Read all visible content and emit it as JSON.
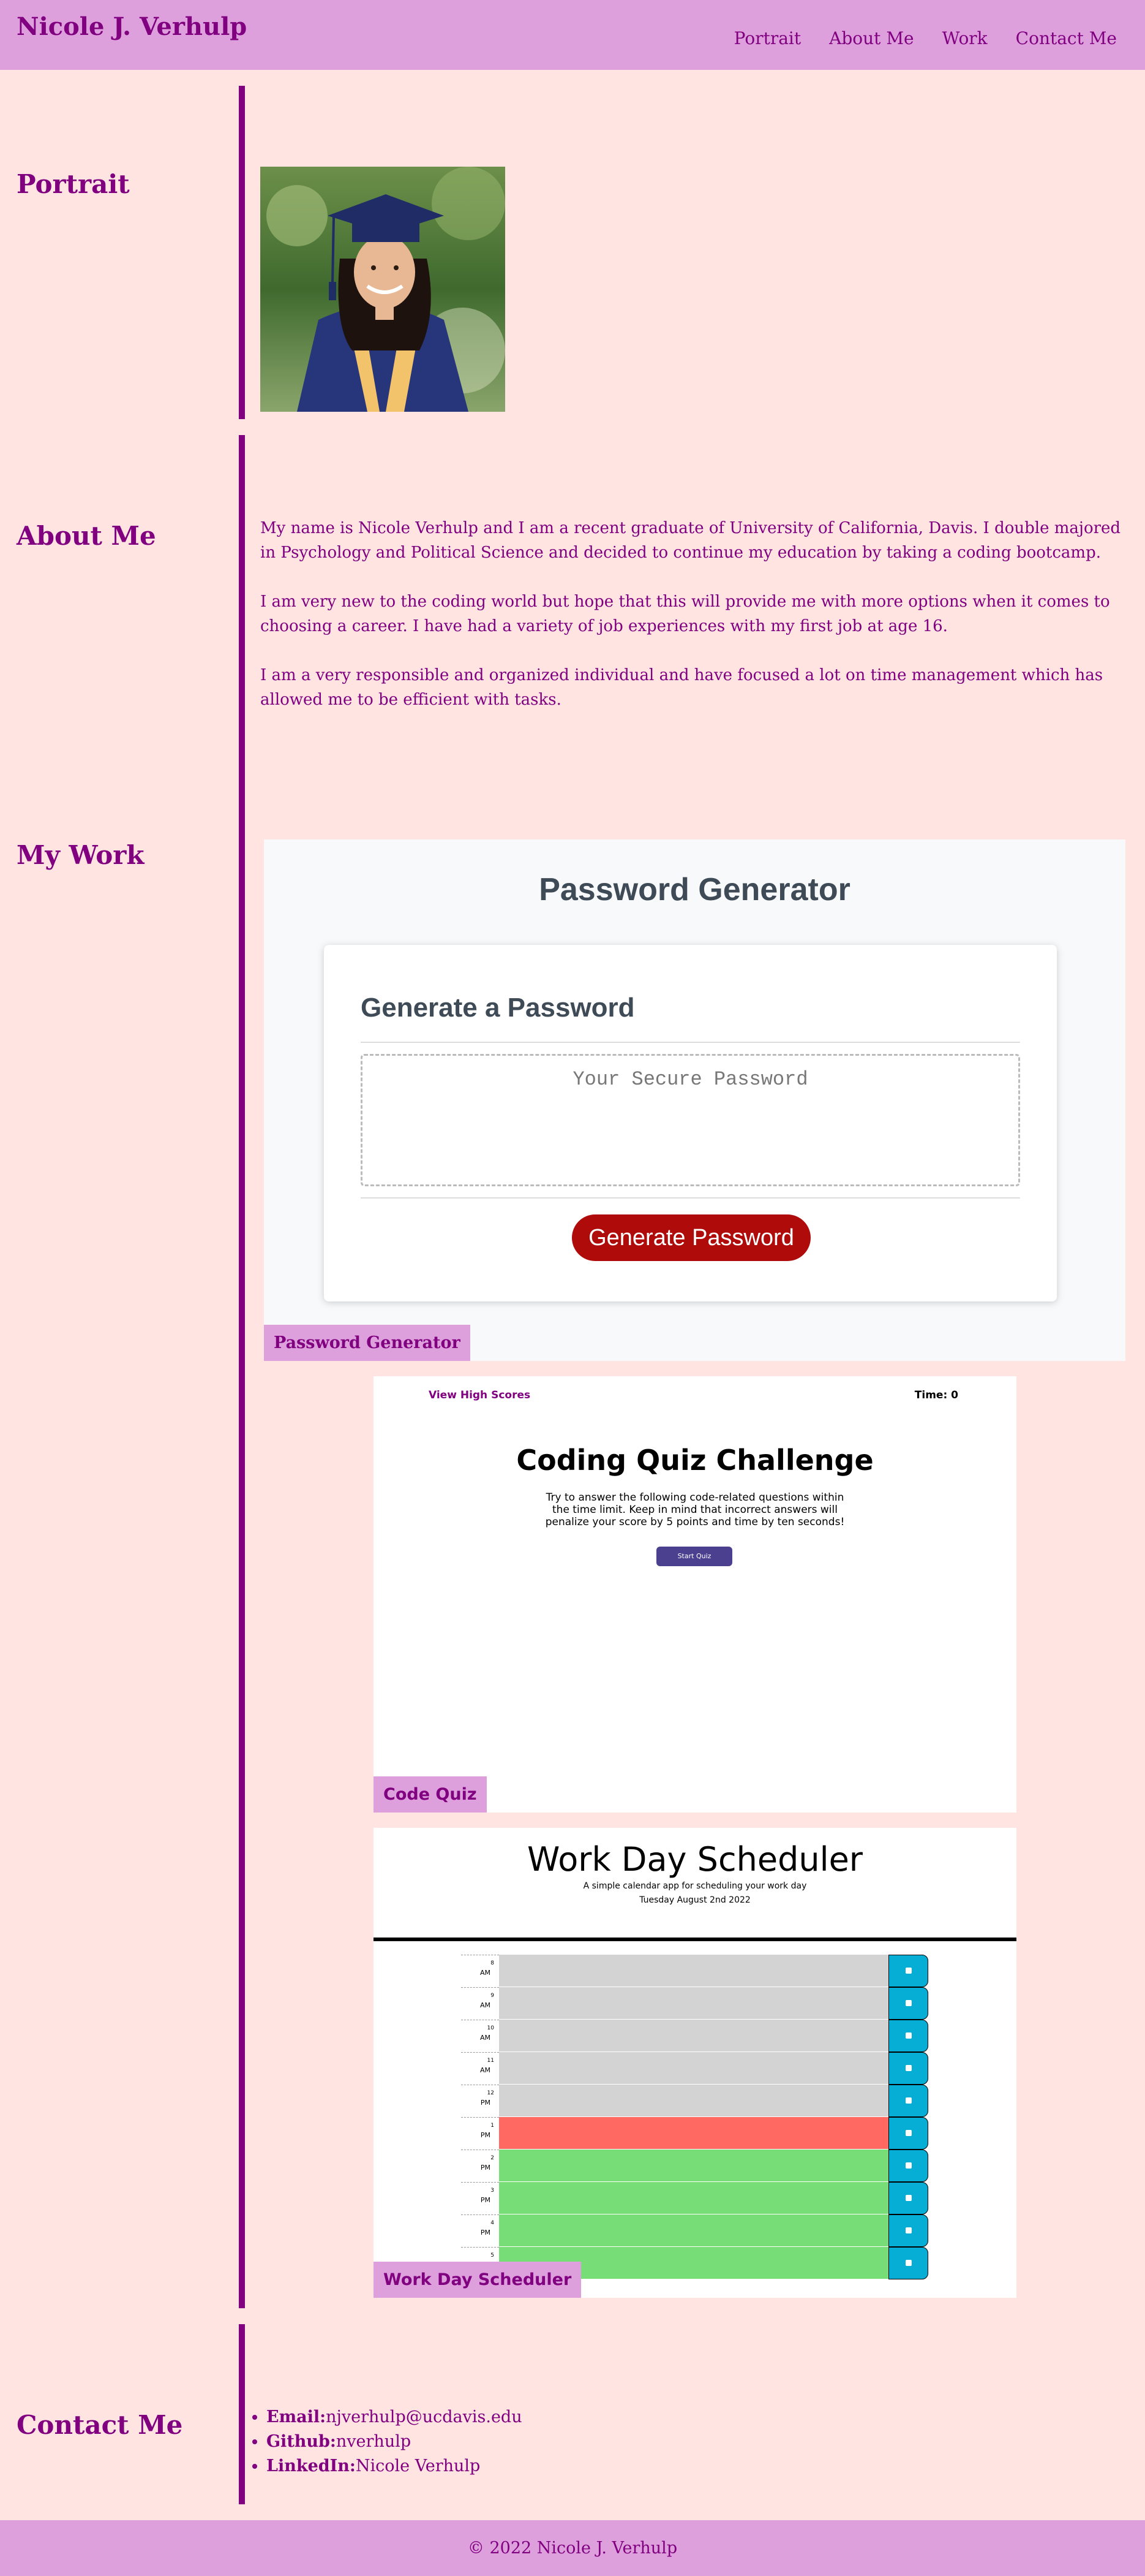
{
  "header": {
    "brand": "Nicole J. Verhulp",
    "nav": [
      "Portrait",
      "About Me",
      "Work",
      "Contact Me"
    ]
  },
  "portrait": {
    "heading": "Portrait"
  },
  "about": {
    "heading": "About Me",
    "paragraphs": [
      "My name is Nicole Verhulp and I am a recent graduate of University of California, Davis. I double majored in Psychology and Political Science and decided to continue my education by taking a coding bootcamp.",
      "I am very new to the coding world but hope that this will provide me with more options when it comes to choosing a career. I have had a variety of job experiences with my first job at age 16.",
      "I am a very responsible and organized individual and have focused a lot on time management which has allowed me to be efficient with tasks."
    ]
  },
  "work": {
    "heading": "My Work",
    "projects": [
      {
        "label": "Password Generator",
        "screenshot": {
          "title": "Password Generator",
          "subtitle": "Generate a Password",
          "placeholder": "Your Secure Password",
          "button": "Generate Password"
        }
      },
      {
        "label": "Code Quiz",
        "screenshot": {
          "high_scores": "View High Scores",
          "time": "Time: 0",
          "title": "Coding Quiz Challenge",
          "text": "Try to answer the following code-related questions within the time limit. Keep in mind that incorrect answers will penalize your score by 5 points and time by ten seconds!",
          "button": "Start Quiz"
        }
      },
      {
        "label": "Work Day Scheduler",
        "screenshot": {
          "title": "Work Day Scheduler",
          "subtitle": "A simple calendar app for scheduling your work day",
          "date": "Tuesday August 2nd 2022",
          "hours": [
            {
              "h": "8",
              "m": "AM",
              "state": "past"
            },
            {
              "h": "9",
              "m": "AM",
              "state": "past"
            },
            {
              "h": "10",
              "m": "AM",
              "state": "past"
            },
            {
              "h": "11",
              "m": "AM",
              "state": "past"
            },
            {
              "h": "12",
              "m": "PM",
              "state": "past"
            },
            {
              "h": "1",
              "m": "PM",
              "state": "present"
            },
            {
              "h": "2",
              "m": "PM",
              "state": "future"
            },
            {
              "h": "3",
              "m": "PM",
              "state": "future"
            },
            {
              "h": "4",
              "m": "PM",
              "state": "future"
            },
            {
              "h": "5",
              "m": "PM",
              "state": "future"
            }
          ]
        }
      }
    ]
  },
  "contact": {
    "heading": "Contact Me",
    "items": [
      {
        "label": "Email:",
        "value": "njverhulp@ucdavis.edu"
      },
      {
        "label": "Github:",
        "value": "nverhulp"
      },
      {
        "label": "LinkedIn:",
        "value": "Nicole Verhulp"
      }
    ]
  },
  "footer": {
    "text": "© 2022 Nicole J. Verhulp"
  },
  "colors": {
    "background": "#ffe4e1",
    "header": "#dda0dd",
    "text": "#800080",
    "pw_button": "#b00b0b",
    "save_button": "#06aed5",
    "past": "#d3d3d3",
    "present": "#ff6961",
    "future": "#77dd77"
  }
}
